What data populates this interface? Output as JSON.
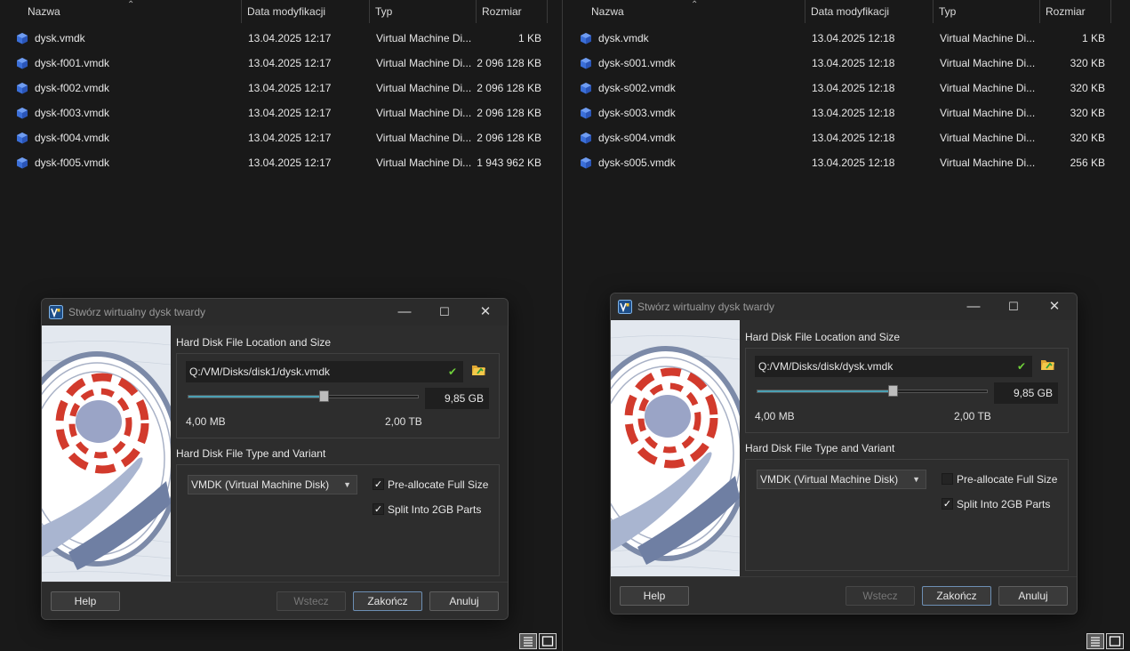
{
  "columns": {
    "name": "Nazwa",
    "date": "Data modyfikacji",
    "type": "Typ",
    "size": "Rozmiar"
  },
  "left_files": [
    {
      "name": "dysk.vmdk",
      "date": "13.04.2025 12:17",
      "type": "Virtual Machine Di...",
      "size": "1 KB"
    },
    {
      "name": "dysk-f001.vmdk",
      "date": "13.04.2025 12:17",
      "type": "Virtual Machine Di...",
      "size": "2 096 128 KB"
    },
    {
      "name": "dysk-f002.vmdk",
      "date": "13.04.2025 12:17",
      "type": "Virtual Machine Di...",
      "size": "2 096 128 KB"
    },
    {
      "name": "dysk-f003.vmdk",
      "date": "13.04.2025 12:17",
      "type": "Virtual Machine Di...",
      "size": "2 096 128 KB"
    },
    {
      "name": "dysk-f004.vmdk",
      "date": "13.04.2025 12:17",
      "type": "Virtual Machine Di...",
      "size": "2 096 128 KB"
    },
    {
      "name": "dysk-f005.vmdk",
      "date": "13.04.2025 12:17",
      "type": "Virtual Machine Di...",
      "size": "1 943 962 KB"
    }
  ],
  "right_files": [
    {
      "name": "dysk.vmdk",
      "date": "13.04.2025 12:18",
      "type": "Virtual Machine Di...",
      "size": "1 KB"
    },
    {
      "name": "dysk-s001.vmdk",
      "date": "13.04.2025 12:18",
      "type": "Virtual Machine Di...",
      "size": "320 KB"
    },
    {
      "name": "dysk-s002.vmdk",
      "date": "13.04.2025 12:18",
      "type": "Virtual Machine Di...",
      "size": "320 KB"
    },
    {
      "name": "dysk-s003.vmdk",
      "date": "13.04.2025 12:18",
      "type": "Virtual Machine Di...",
      "size": "320 KB"
    },
    {
      "name": "dysk-s004.vmdk",
      "date": "13.04.2025 12:18",
      "type": "Virtual Machine Di...",
      "size": "320 KB"
    },
    {
      "name": "dysk-s005.vmdk",
      "date": "13.04.2025 12:18",
      "type": "Virtual Machine Di...",
      "size": "256 KB"
    }
  ],
  "dialogs": [
    {
      "title": "Stwórz wirtualny dysk twardy",
      "section1": "Hard Disk File Location and Size",
      "path": "Q:/VM/Disks/disk1/dysk.vmdk",
      "size_value": "9,85 GB",
      "slider_fraction": 0.59,
      "min_label": "4,00 MB",
      "max_label": "2,00 TB",
      "section2": "Hard Disk File Type and Variant",
      "format": "VMDK (Virtual Machine Disk)",
      "preallocate_label": "Pre-allocate Full Size",
      "preallocate_checked": true,
      "split_label": "Split Into 2GB Parts",
      "split_checked": true,
      "help": "Help",
      "back": "Wstecz",
      "finish": "Zakończ",
      "cancel": "Anuluj"
    },
    {
      "title": "Stwórz wirtualny dysk twardy",
      "section1": "Hard Disk File Location and Size",
      "path": "Q:/VM/Disks/disk/dysk.vmdk",
      "size_value": "9,85 GB",
      "slider_fraction": 0.59,
      "min_label": "4,00 MB",
      "max_label": "2,00 TB",
      "section2": "Hard Disk File Type and Variant",
      "format": "VMDK (Virtual Machine Disk)",
      "preallocate_label": "Pre-allocate Full Size",
      "preallocate_checked": false,
      "split_label": "Split Into 2GB Parts",
      "split_checked": true,
      "help": "Help",
      "back": "Wstecz",
      "finish": "Zakończ",
      "cancel": "Anuluj"
    }
  ],
  "icons": {
    "file": "vmdk-cube-icon",
    "check": "check-icon",
    "folder": "folder-open-icon"
  },
  "colors": {
    "cube": "#3b6fd8",
    "accent": "#4aa0b3",
    "check": "#6fcf3a"
  }
}
